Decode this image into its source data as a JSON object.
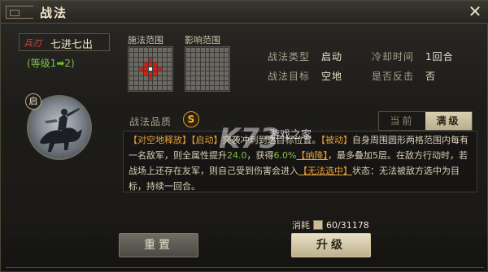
{
  "window": {
    "title": "战法",
    "close_label": "✕"
  },
  "tactic": {
    "type_tag": "兵刃",
    "name": "七进七出",
    "level_prefix": "(等级1",
    "level_arrow": "➡",
    "level_suffix": "2)",
    "portrait_badge": "启"
  },
  "ranges": {
    "cast_label": "施法范围",
    "effect_label": "影响范围"
  },
  "info": {
    "type_label": "战法类型",
    "type_value": "启动",
    "target_label": "战法目标",
    "target_value": "空地",
    "cooldown_label": "冷却时间",
    "cooldown_value": "1回合",
    "counter_label": "是否反击",
    "counter_value": "否"
  },
  "quality": {
    "label": "战法品质",
    "grade": "S"
  },
  "tabs": {
    "current": "当前",
    "full": "满级"
  },
  "description": {
    "tag1": "【对空地释放】",
    "tag2": "【启动】",
    "text1": "突袭冲刺到达目标位置。",
    "tag3": "【被动】",
    "text2": "自身周围圆形两格范围内每有一名敌军，则全属性提升",
    "value1": "24.0",
    "text3": "，获得",
    "value2": "6.0%",
    "tag4": "【纳降】",
    "text4": "，最多叠加5层。在敌方行动时，若战场上还存在友军，则自己受到伤害会进入",
    "tag5": "【无法选中】",
    "text5": "状态：无法被敌方选中为目标，持续一回合。"
  },
  "watermark": {
    "logo": "K73",
    "site": "游戏之家"
  },
  "cost": {
    "label": "消耗",
    "value": "60/31178"
  },
  "buttons": {
    "reset": "重置",
    "upgrade": "升级"
  }
}
